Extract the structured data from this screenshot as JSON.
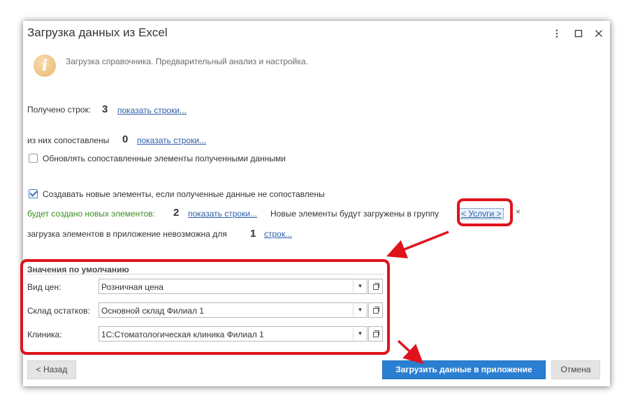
{
  "window": {
    "title": "Загрузка данных из Excel",
    "menu_icon": "more-vertical-icon",
    "maximize_icon": "maximize-icon",
    "close_icon": "close-icon"
  },
  "info": {
    "icon": "info-icon",
    "text": "Загрузка справочника. Предварительный анализ и настройка."
  },
  "received": {
    "label": "Получено строк:",
    "count": "3",
    "link": "показать строки..."
  },
  "matched": {
    "label": "из них сопоставлены",
    "count": "0",
    "link": "показать строки..."
  },
  "update_checkbox": {
    "checked": false,
    "label": "Обновлять сопоставленные элементы полученными данными"
  },
  "create_checkbox": {
    "checked": true,
    "label": "Создавать новые элементы, если полученные данные не сопоставлены"
  },
  "new_elements": {
    "label": "будет создано новых элементов:",
    "count": "2",
    "link": "показать строки...",
    "group_text": "Новые элементы будут загружены в группу",
    "group_link": "< Услуги >",
    "clear": "×"
  },
  "impossible": {
    "label": "загрузка элементов в приложение невозможна для",
    "count": "1",
    "link": "строк..."
  },
  "defaults": {
    "title": "Значения по умолчанию",
    "fields": [
      {
        "label": "Вид цен:",
        "value": "Розничная цена"
      },
      {
        "label": "Склад остатков:",
        "value": "Основной склад Филиал 1"
      },
      {
        "label": "Клиника:",
        "value": "1С:Стоматологическая клиника Филиал 1"
      }
    ]
  },
  "buttons": {
    "back": "< Назад",
    "load": "Загрузить данные в приложение",
    "cancel": "Отмена"
  },
  "colors": {
    "annotation_red": "#e0131c",
    "primary_button": "#2a7fd2",
    "link": "#2c5ea8",
    "green_text": "#3a8c1e"
  }
}
